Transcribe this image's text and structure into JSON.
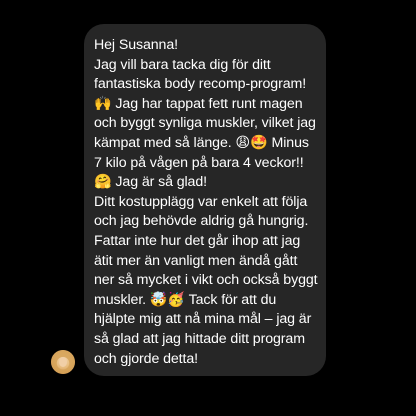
{
  "message": {
    "text": "Hej Susanna!\nJag vill bara tacka dig för ditt fantastiska body recomp-program! 🙌 Jag har tappat fett runt magen och byggt synliga muskler, vilket jag kämpat med så länge. 😩🤩 Minus 7 kilo på vågen på bara 4 veckor!! 🤗 Jag är så glad!\nDitt kostupplägg var enkelt att följa och jag behövde aldrig gå hungrig. Fattar inte hur det går ihop att jag ätit mer än vanligt men ändå gått ner så mycket i vikt och också byggt muskler. 🤯🥳 Tack för att du hjälpte mig att nå mina mål – jag är så glad att jag hittade ditt program och gjorde detta!"
  },
  "colors": {
    "background": "#000000",
    "bubble": "#262626",
    "text": "#ffffff"
  },
  "avatar": {
    "icon": "user-avatar"
  }
}
